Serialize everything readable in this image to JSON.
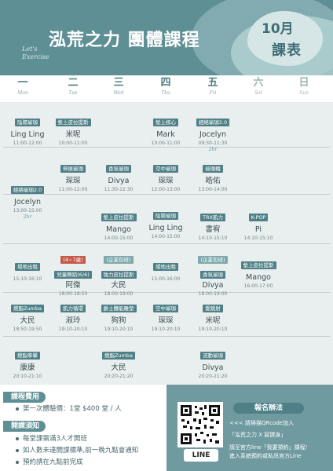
{
  "header": {
    "title": "泓荒之力 團體課程",
    "script_line1": "Let's",
    "script_line2": "Exercise",
    "month_number": "10月",
    "month_label": "課表"
  },
  "days": [
    {
      "zh": "一",
      "en": "Mon"
    },
    {
      "zh": "二",
      "en": "Tue"
    },
    {
      "zh": "三",
      "en": "Wed"
    },
    {
      "zh": "四",
      "en": "Thu"
    },
    {
      "zh": "五",
      "en": "Fri"
    },
    {
      "zh": "六",
      "en": "Sat"
    },
    {
      "zh": "日",
      "en": "Sun"
    }
  ],
  "classes": {
    "r1_mon": {
      "name": "陰陽瑜珈",
      "teacher": "Ling Ling",
      "time": "11:00-12:00"
    },
    "r1_tue": {
      "name": "墊上皮拉提斯",
      "teacher": "米呢",
      "time": "10:00-11:00"
    },
    "r1_thu": {
      "name": "墊上核心",
      "teacher": "Mark",
      "time": "10:00-11:00"
    },
    "r1_fri": {
      "name": "經絡瑜珈2.0",
      "teacher": "Jocelyn",
      "time": "09:30-11:30",
      "note": "2hr"
    },
    "r2_tue": {
      "name": "伸展瑜珈",
      "teacher": "琛琛",
      "time": "11:00-12:00"
    },
    "r2_wed": {
      "name": "香氛瑜珈",
      "teacher": "Divya",
      "time": "11:30-12:30"
    },
    "r2_thu": {
      "name": "空中瑜珈",
      "teacher": "琛琛",
      "time": "12:00-13:00"
    },
    "r2_fri": {
      "name": "瑜珈輪",
      "teacher": "皓佑",
      "time": "13:00-14:00"
    },
    "r3_mon": {
      "name": "經絡瑜珈2.0",
      "teacher": "Jocelyn",
      "time": "13:00-15:00",
      "note": "2hr"
    },
    "r3_wed": {
      "name": "墊上皮拉提斯",
      "teacher": "Mango",
      "time": "14:00-15:00"
    },
    "r3_thu": {
      "name": "陰陽瑜珈",
      "teacher": "Ling Ling",
      "time": "14:00-15:00"
    },
    "r3_fri": {
      "name": "TRX肌力",
      "teacher": "書宥",
      "time": "14:10-15:10"
    },
    "r3_sat": {
      "name": "K-POP",
      "teacher": "Pi",
      "time": "14:10-15:10"
    },
    "r4_mon": {
      "name": "場地出租",
      "teacher": "",
      "time": "15:10-16:10"
    },
    "r4_tue": {
      "name": "兒童舞蹈(6/6)",
      "prefix": "(4~7歲)",
      "teacher": "阿傑",
      "time": "18:00-18:50"
    },
    "r4_wed": {
      "name": "強力皮拉提斯",
      "prefix": "(企業包班)",
      "teacher": "大民",
      "time": "18:00-19:00"
    },
    "r4_thu": {
      "name": "場地出租",
      "teacher": "",
      "time": "15:00-16:00"
    },
    "r4_fri": {
      "name": "香氛瑜珈",
      "prefix": "(企業包班)",
      "teacher": "Divya",
      "time": "18:00-19:00"
    },
    "r4_sat": {
      "name": "墊上皮拉提斯",
      "teacher": "Mango",
      "time": "16:00-17:00"
    },
    "r5_mon": {
      "name": "燃脂Zumba",
      "teacher": "大民",
      "time": "18:50-19:50"
    },
    "r5_tue": {
      "name": "肌力循環",
      "teacher": "淑玲",
      "time": "19:10-20:10"
    },
    "r5_wed": {
      "name": "爵士體能雕塑",
      "teacher": "狗狗",
      "time": "19:10-20:10"
    },
    "r5_thu": {
      "name": "空中瑜珈",
      "teacher": "琛琛",
      "time": "19:10-20:10"
    },
    "r5_fri": {
      "name": "愛跳射",
      "teacher": "米呢",
      "time": "19:10-20:10"
    },
    "r6_mon": {
      "name": "燃脂拳擊",
      "teacher": "康康",
      "time": "20:10-21:10"
    },
    "r6_wed": {
      "name": "燃脂Zumba",
      "teacher": "大民",
      "time": "20:20-21:20"
    },
    "r6_fri": {
      "name": "流動瑜珈",
      "teacher": "Divya",
      "time": "20:20-21:20"
    }
  },
  "fees": {
    "title": "課程費用",
    "item1": "第一次體驗價：1堂 $400 堂 / 人"
  },
  "rules": {
    "title": "開課須知",
    "item1": "每堂課需滿3人才開班",
    "item2": "如人數未達開課標準,前一晚九點會通知",
    "item3": "預約請在九點前完成"
  },
  "signup": {
    "title": "報名辦法",
    "line1": "<<< 請掃描QRcode加入",
    "line2": "「泓荒之力 X 宸健身」",
    "line3": "請至官方line「我要預約」課程!",
    "line4": "進入系統預約或私訊官方Line",
    "qr_label": "LINE"
  },
  "colors": {
    "primary": "#5e8f95",
    "tag": "#4f8087",
    "accent_red": "#c55a4a",
    "board": "#e9eeee"
  }
}
